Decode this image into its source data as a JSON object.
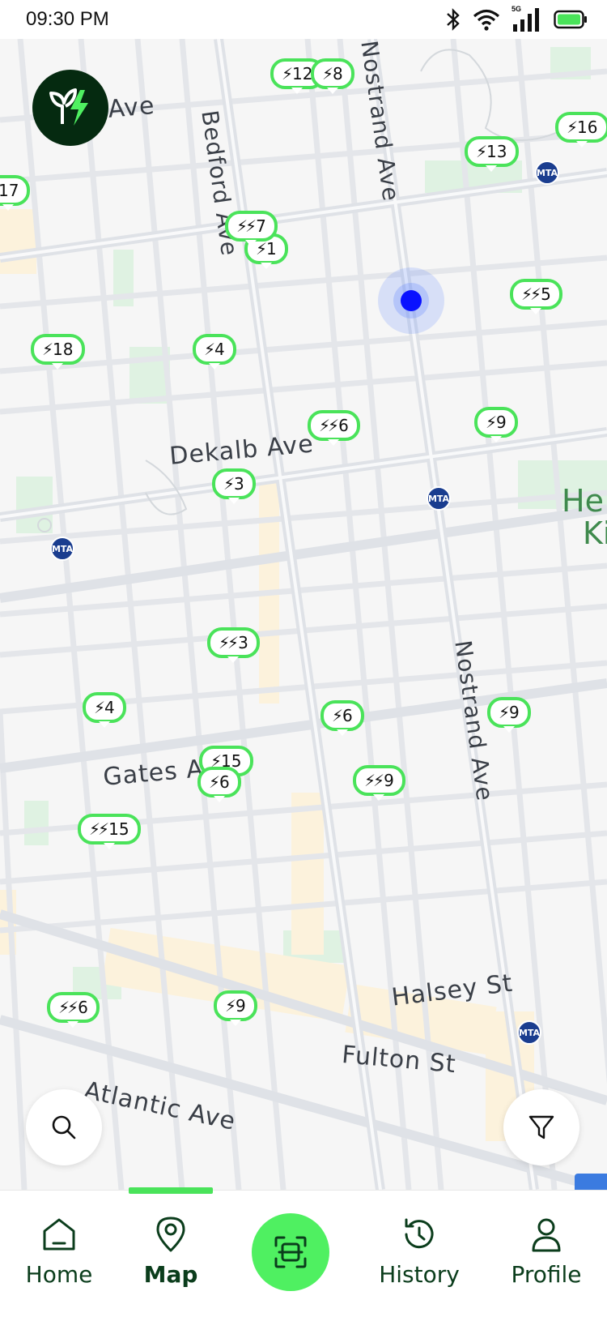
{
  "status_bar": {
    "time": "09:30 PM",
    "network": "5G"
  },
  "map": {
    "streets": {
      "ave_top": "Ave",
      "bedford": "Bedford Ave",
      "nostrand_top": "Nostrand Ave",
      "dekalb": "Dekalb Ave",
      "gates": "Gates Ave",
      "nostrand_bottom": "Nostrand Ave",
      "halsey": "Halsey St",
      "fulton": "Fulton St",
      "atlantic": "Atlantic Ave"
    },
    "place_label": {
      "line1": "He",
      "line2": "Ki"
    },
    "mta_label": "MTA",
    "markers": [
      {
        "id": "m1",
        "bolts": "⚡",
        "count": "12"
      },
      {
        "id": "m2",
        "bolts": "⚡",
        "count": "8"
      },
      {
        "id": "m3",
        "bolts": "⚡",
        "count": "16"
      },
      {
        "id": "m4",
        "bolts": "⚡",
        "count": "13"
      },
      {
        "id": "m5",
        "bolts": "",
        "count": "17"
      },
      {
        "id": "m6",
        "bolts": "⚡⚡",
        "count": "7"
      },
      {
        "id": "m7",
        "bolts": "⚡",
        "count": "1"
      },
      {
        "id": "m8",
        "bolts": "⚡⚡",
        "count": "5"
      },
      {
        "id": "m9",
        "bolts": "⚡",
        "count": "18"
      },
      {
        "id": "m10",
        "bolts": "⚡",
        "count": "4"
      },
      {
        "id": "m11",
        "bolts": "⚡⚡",
        "count": "6"
      },
      {
        "id": "m12",
        "bolts": "⚡",
        "count": "9"
      },
      {
        "id": "m13",
        "bolts": "⚡",
        "count": "3"
      },
      {
        "id": "m14",
        "bolts": "⚡⚡",
        "count": "3"
      },
      {
        "id": "m15",
        "bolts": "⚡",
        "count": "4"
      },
      {
        "id": "m16",
        "bolts": "⚡",
        "count": "6"
      },
      {
        "id": "m17",
        "bolts": "⚡",
        "count": "9"
      },
      {
        "id": "m18",
        "bolts": "⚡",
        "count": "15"
      },
      {
        "id": "m19",
        "bolts": "⚡",
        "count": "6"
      },
      {
        "id": "m20",
        "bolts": "⚡⚡",
        "count": "9"
      },
      {
        "id": "m21",
        "bolts": "⚡⚡",
        "count": "15"
      },
      {
        "id": "m22",
        "bolts": "⚡⚡",
        "count": "6"
      },
      {
        "id": "m23",
        "bolts": "⚡",
        "count": "9"
      }
    ]
  },
  "nav": {
    "home": "Home",
    "map": "Map",
    "history": "History",
    "profile": "Profile"
  },
  "colors": {
    "accent": "#4ae35a",
    "brand_dark": "#052a10",
    "nav_text": "#0b3d1c",
    "user_dot": "#0a12ff",
    "mta": "#1a3d8f"
  }
}
